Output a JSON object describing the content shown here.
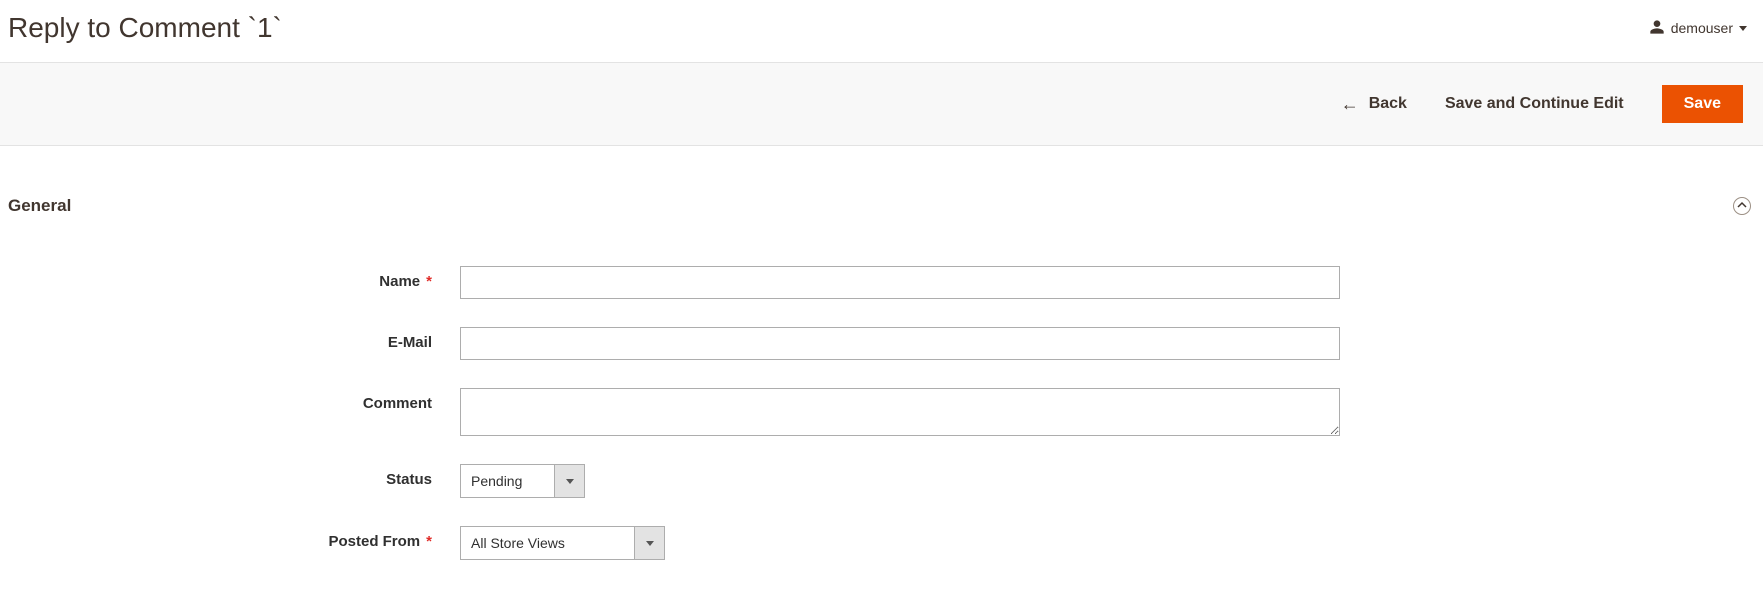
{
  "header": {
    "title": "Reply to Comment `1`",
    "username": "demouser"
  },
  "actions": {
    "back": "Back",
    "save_continue": "Save and Continue Edit",
    "save": "Save"
  },
  "section": {
    "title": "General"
  },
  "form": {
    "name": {
      "label": "Name",
      "value": "",
      "required": true
    },
    "email": {
      "label": "E-Mail",
      "value": "",
      "required": false
    },
    "comment": {
      "label": "Comment",
      "value": "",
      "required": false
    },
    "status": {
      "label": "Status",
      "value": "Pending",
      "required": false
    },
    "posted_from": {
      "label": "Posted From",
      "value": "All Store Views",
      "required": true
    }
  }
}
